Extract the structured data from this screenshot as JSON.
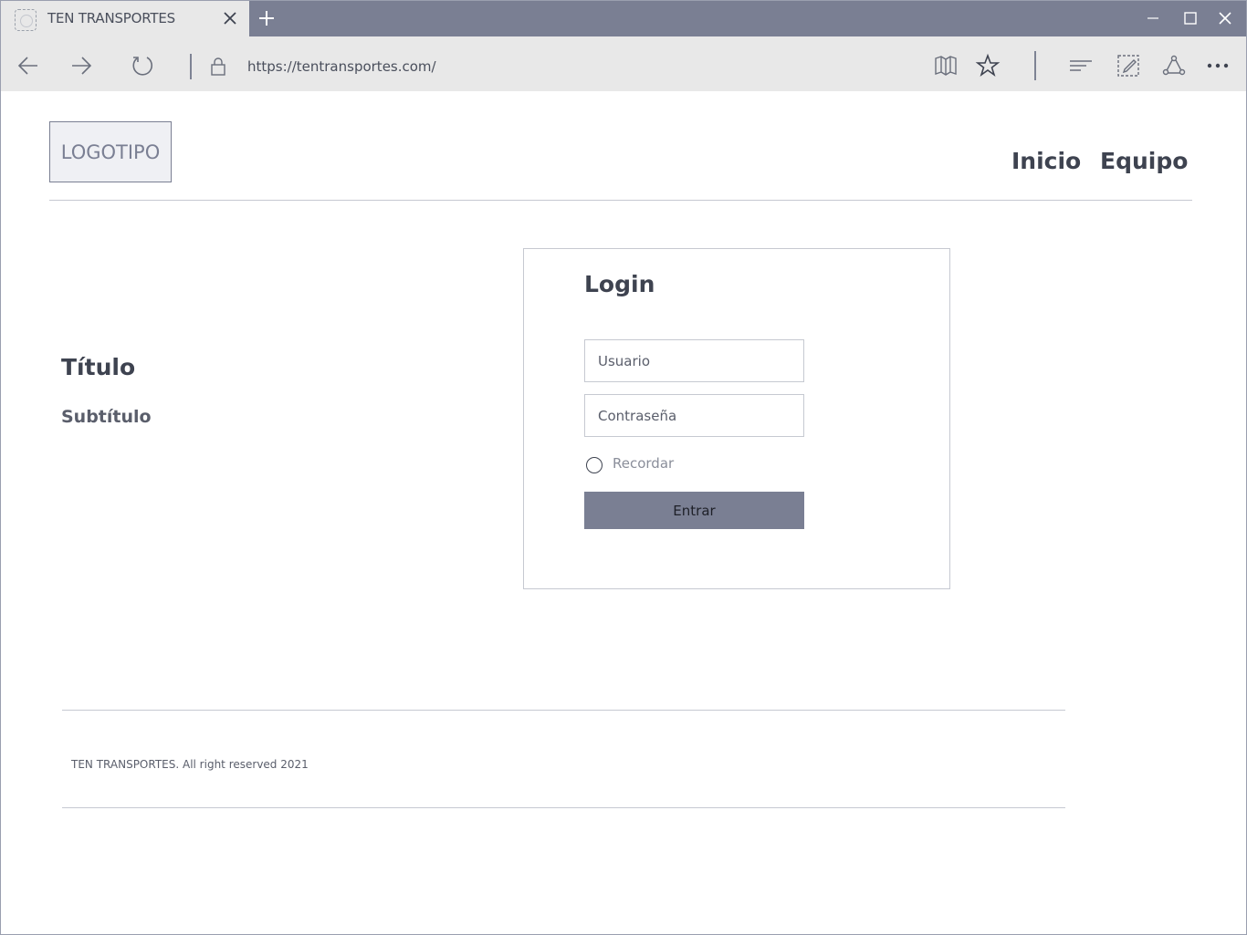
{
  "browser": {
    "tab_title": "TEN TRANSPORTES",
    "url": "https://tentransportes.com/"
  },
  "header": {
    "logo_text": "LOGOTIPO",
    "nav": [
      {
        "label": "Inicio"
      },
      {
        "label": "Equipo"
      }
    ]
  },
  "hero": {
    "title": "Título",
    "subtitle": "Subtítulo"
  },
  "login": {
    "title": "Login",
    "username_placeholder": "Usuario",
    "password_placeholder": "Contraseña",
    "remember_label": "Recordar",
    "remember_checked": false,
    "submit_label": "Entrar"
  },
  "footer": {
    "text": "TEN TRANSPORTES. All right reserved 2021"
  },
  "colors": {
    "tabbar": "#7a7f93",
    "chrome": "#e8e8e8",
    "primary_button": "#7a7f93",
    "text_dark": "#3e4350",
    "border": "#c6c9d1"
  },
  "icons": [
    "favicon-icon",
    "close-icon",
    "plus-icon",
    "minimize-icon",
    "maximize-icon",
    "back-icon",
    "forward-icon",
    "refresh-icon",
    "lock-icon",
    "reading-view-icon",
    "star-icon",
    "hub-icon",
    "web-note-icon",
    "share-icon",
    "more-icon"
  ]
}
